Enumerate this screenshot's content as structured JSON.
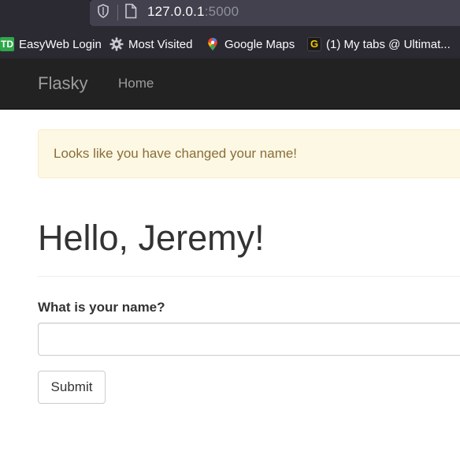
{
  "browser": {
    "url_host": "127.0.0.1",
    "url_port": ":5000",
    "bookmarks": [
      {
        "label": "EasyWeb Login",
        "icon": "td-bank-icon",
        "icon_text": "TD"
      },
      {
        "label": "Most Visited",
        "icon": "gear-icon"
      },
      {
        "label": "Google Maps",
        "icon": "map-pin-icon"
      },
      {
        "label": "(1) My tabs @ Ultimat...",
        "icon": "ultimate-guitar-icon",
        "icon_text": "G"
      }
    ]
  },
  "navbar": {
    "brand": "Flasky",
    "home_label": "Home"
  },
  "alert": {
    "message": "Looks like you have changed your name!"
  },
  "main": {
    "heading": "Hello, Jeremy!"
  },
  "form": {
    "label": "What is your name?",
    "name_value": "",
    "submit_label": "Submit"
  },
  "colors": {
    "navbar_bg": "#222222",
    "alert_bg": "#fcf8e3",
    "alert_text": "#8a6d3b",
    "browser_chrome": "#2b2a33"
  }
}
